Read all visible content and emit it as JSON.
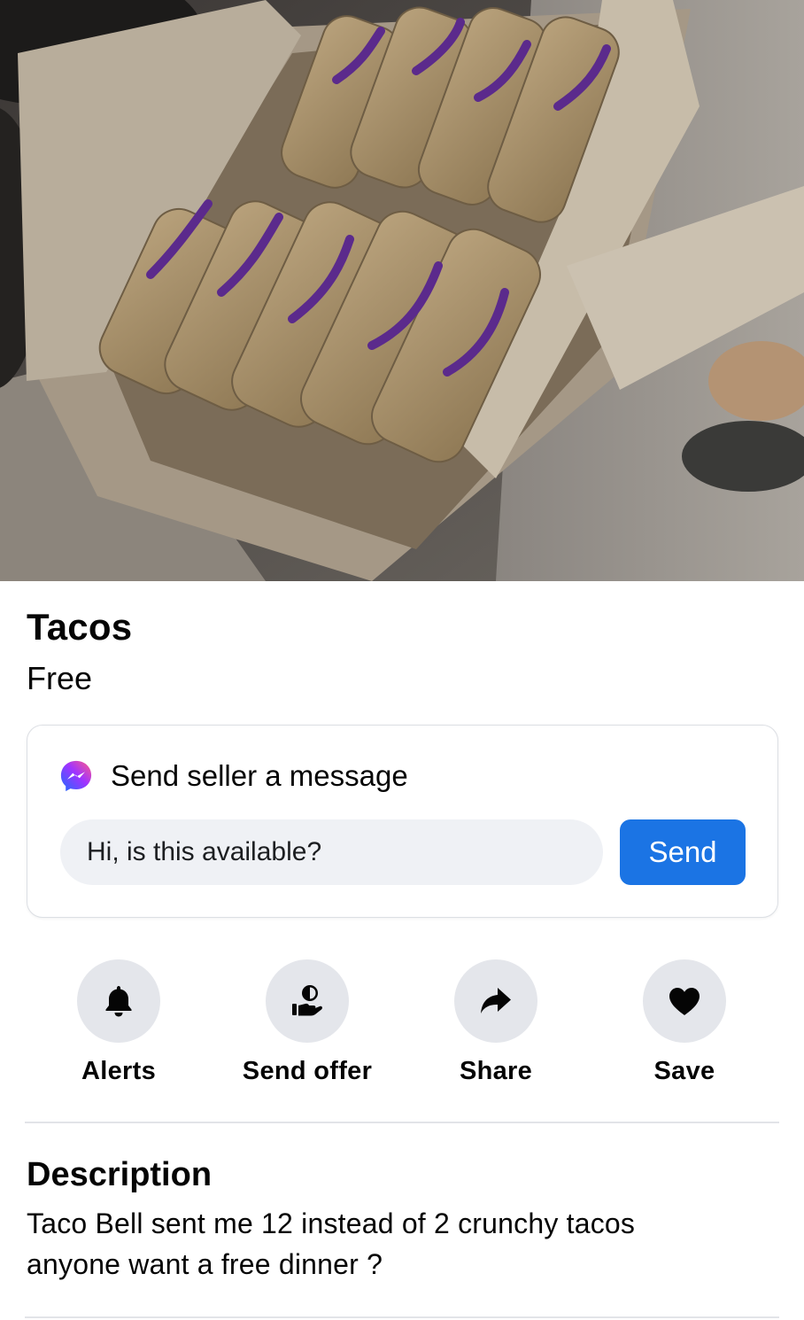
{
  "listing": {
    "title": "Tacos",
    "price": "Free"
  },
  "message_card": {
    "header": "Send seller a message",
    "input_value": "Hi, is this available?",
    "send_label": "Send",
    "icon": "messenger-icon",
    "send_color": "#1b74e4"
  },
  "actions": [
    {
      "label": "Alerts",
      "icon": "bell-icon"
    },
    {
      "label": "Send offer",
      "icon": "offer-icon"
    },
    {
      "label": "Share",
      "icon": "share-arrow-icon"
    },
    {
      "label": "Save",
      "icon": "heart-icon"
    }
  ],
  "description": {
    "heading": "Description",
    "line1": "Taco Bell sent me 12 instead of 2 crunchy tacos",
    "line2": "anyone want a free dinner ?"
  }
}
